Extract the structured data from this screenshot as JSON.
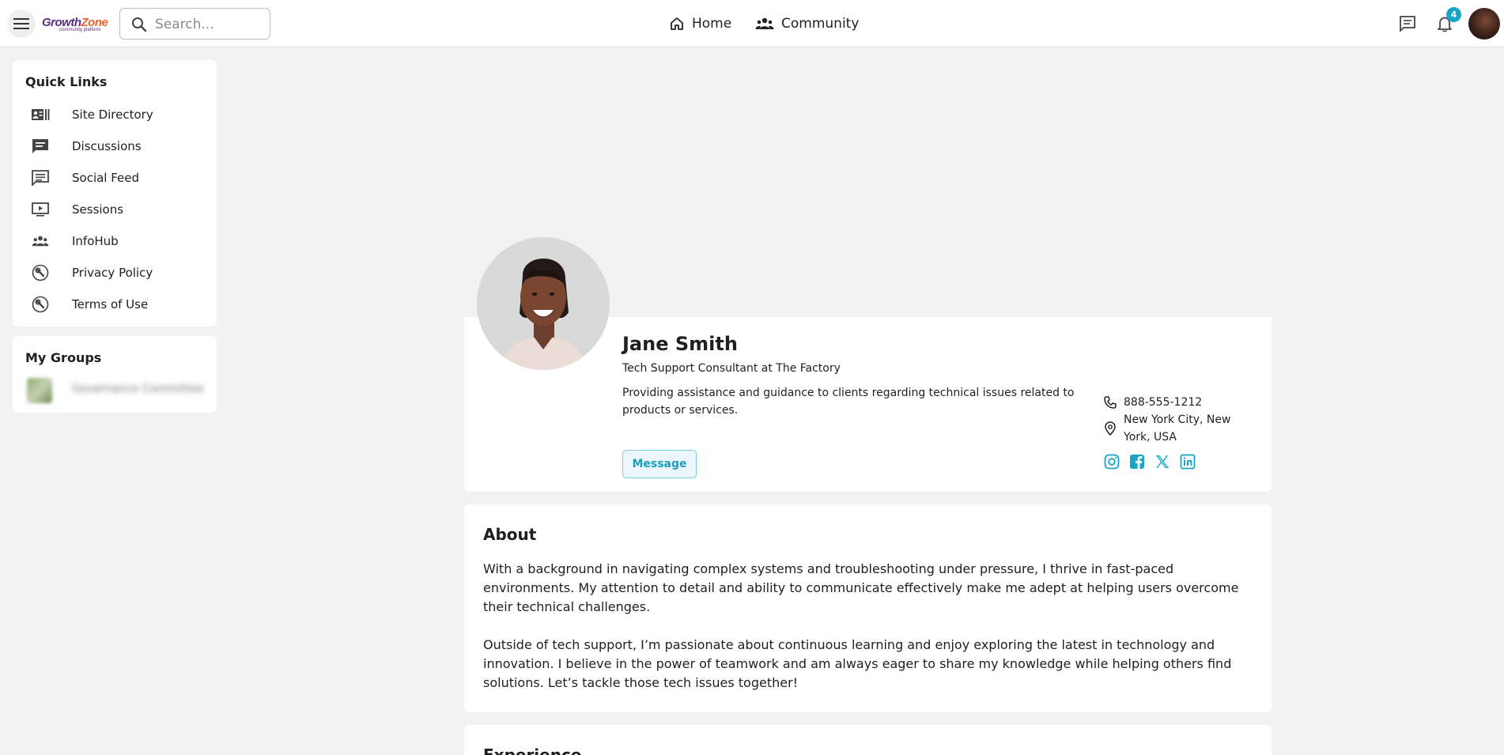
{
  "header": {
    "logo_main": "Growth",
    "logo_accent": "Zone",
    "logo_sub": "community platform",
    "search_placeholder": "Search...",
    "nav": [
      {
        "label": "Home",
        "icon": "home-icon"
      },
      {
        "label": "Community",
        "icon": "people-icon"
      }
    ],
    "notification_count": "4"
  },
  "sidebar": {
    "quick_links_title": "Quick Links",
    "quick_links": [
      {
        "label": "Site Directory",
        "icon": "directory-icon"
      },
      {
        "label": "Discussions",
        "icon": "discussion-icon"
      },
      {
        "label": "Social Feed",
        "icon": "feed-icon"
      },
      {
        "label": "Sessions",
        "icon": "video-icon"
      },
      {
        "label": "InfoHub",
        "icon": "people-icon"
      },
      {
        "label": "Privacy Policy",
        "icon": "wrench-icon"
      },
      {
        "label": "Terms of Use",
        "icon": "wrench-icon"
      }
    ],
    "my_groups_title": "My Groups",
    "groups": [
      {
        "label": "Governance Committee"
      }
    ]
  },
  "profile": {
    "name": "Jane Smith",
    "job_title": "Tech Support Consultant at The Factory",
    "bio": "Providing assistance and guidance to clients regarding technical issues related to products or services.",
    "message_label": "Message",
    "phone": "888-555-1212",
    "location": "New York City, New York, USA",
    "social": [
      "instagram-icon",
      "facebook-icon",
      "x-icon",
      "linkedin-icon"
    ]
  },
  "about": {
    "title": "About",
    "paragraph1": "With a background in navigating complex systems and troubleshooting under pressure, I thrive in fast-paced environments. My attention to detail and ability to communicate effectively make me adept at helping users overcome their technical challenges.",
    "paragraph2": "Outside of tech support, I’m passionate about continuous learning and enjoy exploring the latest in technology and innovation. I believe in the power of teamwork and am always eager to share my knowledge while helping others find solutions. Let’s tackle those tech issues together!"
  },
  "experience": {
    "title": "Experience"
  },
  "colors": {
    "accent": "#1aa5c7",
    "background": "#f2f2f2",
    "brand_purple": "#5a2d82",
    "brand_orange": "#e8632a"
  }
}
